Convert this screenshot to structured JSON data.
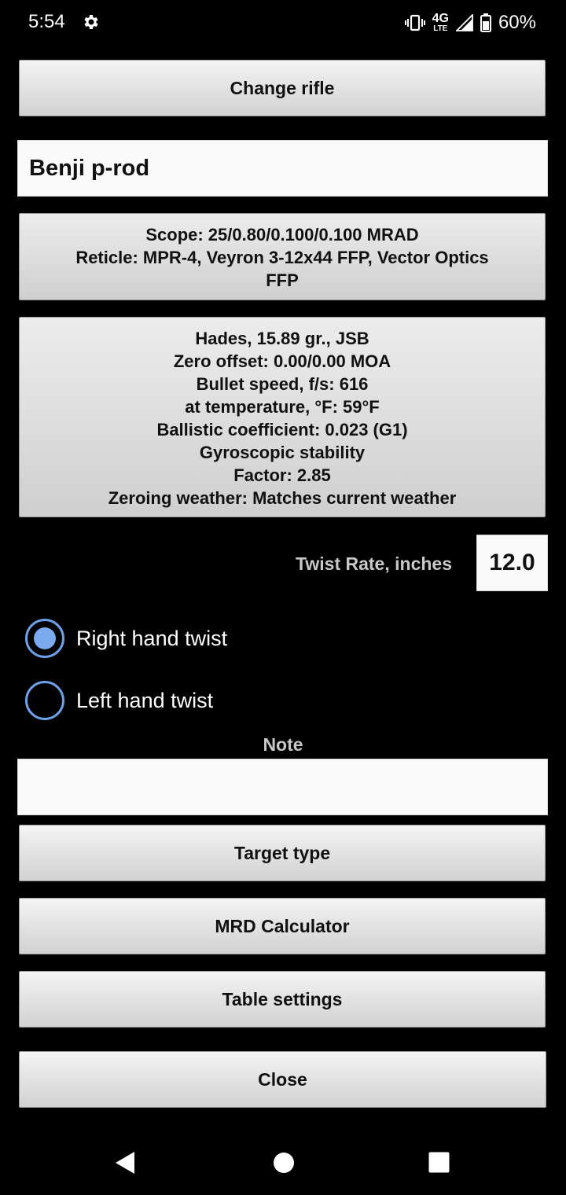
{
  "status_bar": {
    "time": "5:54",
    "network": "4G",
    "network_sub": "LTE",
    "battery": "60%"
  },
  "buttons": {
    "change_rifle": "Change rifle",
    "target_type": "Target type",
    "mrd_calculator": "MRD Calculator",
    "table_settings": "Table settings",
    "close": "Close"
  },
  "rifle_name": "Benji p-rod",
  "scope_info": {
    "line1": "Scope: 25/0.80/0.100/0.100 MRAD",
    "line2": "Reticle: MPR-4, Veyron 3-12x44 FFP, Vector Optics",
    "line3": "FFP"
  },
  "ammo_info": {
    "line1": "Hades, 15.89 gr., JSB",
    "line2": "Zero offset: 0.00/0.00 MOA",
    "line3": "Bullet speed, f/s: 616",
    "line4": "at temperature, °F: 59°F",
    "line5": "Ballistic coefficient: 0.023 (G1)",
    "line6": "Gyroscopic stability",
    "line7": "Factor: 2.85",
    "line8": "Zeroing weather: Matches current weather"
  },
  "twist": {
    "label": "Twist Rate, inches",
    "value": "12.0",
    "right_label": "Right hand twist",
    "left_label": "Left hand twist",
    "selected": "right"
  },
  "note": {
    "label": "Note",
    "value": ""
  },
  "colors": {
    "radio_accent": "#7aa9ee",
    "background": "#000000"
  },
  "icons": {
    "settings": "gear-icon",
    "vibrate": "vibrate-icon",
    "signal": "signal-icon",
    "battery": "battery-icon",
    "back": "back-triangle-icon",
    "home": "home-circle-icon",
    "recents": "recents-square-icon"
  }
}
